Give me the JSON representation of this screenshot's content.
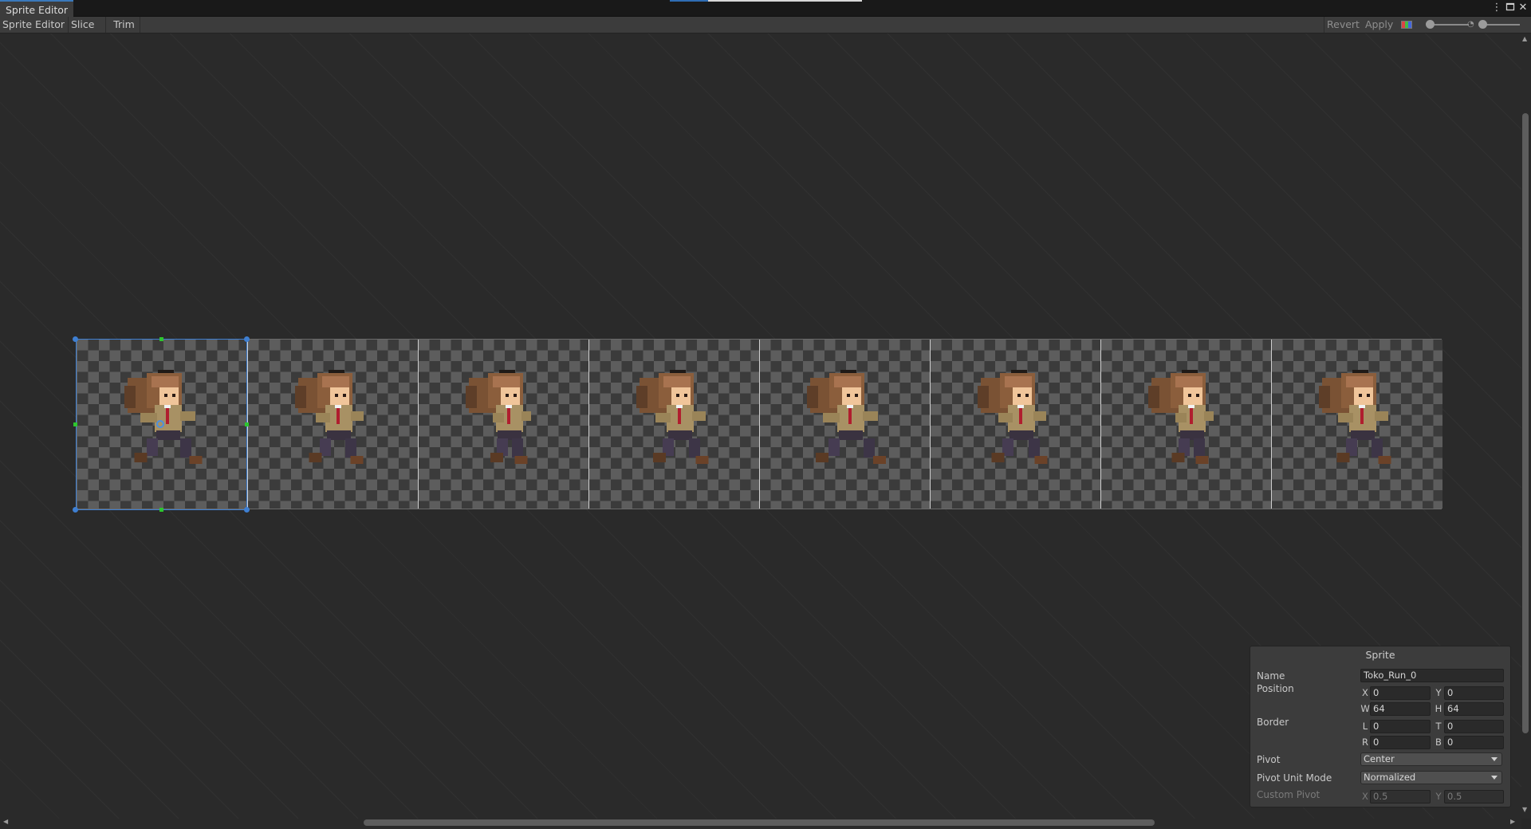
{
  "window": {
    "tab_title": "Sprite Editor",
    "icons": {
      "more": "kebab-menu-icon",
      "maximize": "maximize-icon",
      "close": "close-icon"
    }
  },
  "toolbar": {
    "mode_menu": "Sprite Editor",
    "slice": "Slice",
    "trim": "Trim",
    "revert": "Revert",
    "apply": "Apply",
    "channel_icon": "rgb-channel-icon",
    "zoom_icon": "zoom-slider",
    "mip_icon": "mip-level-slider"
  },
  "canvas": {
    "frame_count": 8,
    "selected_frame": 0,
    "background": "checkerboard"
  },
  "sprite_panel": {
    "title": "Sprite",
    "name_label": "Name",
    "name_value": "Toko_Run_0",
    "position_label": "Position",
    "position": {
      "x_label": "X",
      "x": "0",
      "y_label": "Y",
      "y": "0",
      "w_label": "W",
      "w": "64",
      "h_label": "H",
      "h": "64"
    },
    "border_label": "Border",
    "border": {
      "l_label": "L",
      "l": "0",
      "t_label": "T",
      "t": "0",
      "r_label": "R",
      "r": "0",
      "b_label": "B",
      "b": "0"
    },
    "pivot_label": "Pivot",
    "pivot_value": "Center",
    "pivot_unit_label": "Pivot Unit Mode",
    "pivot_unit_value": "Normalized",
    "custom_pivot_label": "Custom Pivot",
    "custom_pivot": {
      "x_label": "X",
      "x": "0.5",
      "y_label": "Y",
      "y": "0.5"
    }
  },
  "colors": {
    "selection": "#3e7fd2",
    "handle_mid": "#2ec52e",
    "panel_bg": "#3c3c3c",
    "editor_bg": "#282828"
  }
}
